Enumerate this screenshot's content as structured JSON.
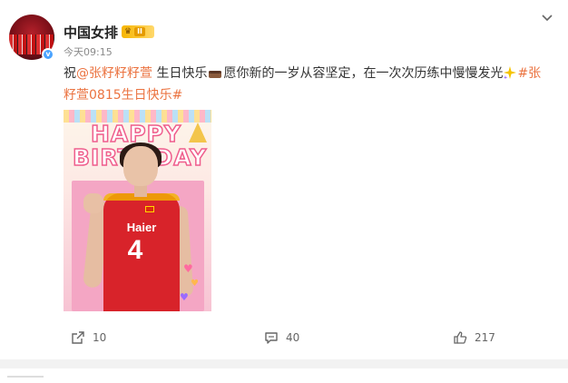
{
  "post": {
    "author": "中国女排",
    "badge_level": "II",
    "time": "今天09:15",
    "text": {
      "prefix": "祝",
      "mention": "@张籽籽籽萱",
      "part1": " 生日快乐",
      "part2": "愿你新的一岁从容坚定，在一次次历练中慢慢发光",
      "hashtag": "#张籽萱0815生日快乐#"
    },
    "image": {
      "line1": "HAPPY",
      "line2": "BIRTHDAY",
      "jersey_brand": "Haier",
      "jersey_number": "4"
    },
    "actions": {
      "shares": "10",
      "comments": "40",
      "likes": "217"
    }
  }
}
